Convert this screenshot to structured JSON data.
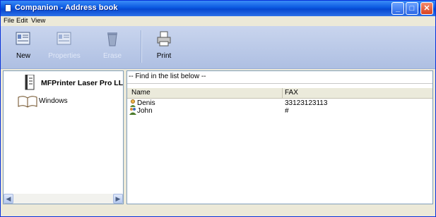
{
  "window": {
    "title": "Companion - Address book"
  },
  "menu": {
    "items": [
      "File",
      "Edit",
      "View"
    ]
  },
  "toolbar": {
    "new_label": "New",
    "properties_label": "Properties",
    "erase_label": "Erase",
    "print_label": "Print"
  },
  "tree": {
    "items": [
      {
        "label": "MFPrinter Laser Pro LL",
        "icon": "printer-book-icon"
      },
      {
        "label": "Windows",
        "icon": "open-book-icon"
      }
    ]
  },
  "find": {
    "placeholder": "-- Find in the list below --"
  },
  "list": {
    "columns": [
      "Name",
      "FAX"
    ],
    "rows": [
      {
        "name": "Denis",
        "fax": "33123123113",
        "icon": "person-icon"
      },
      {
        "name": "John",
        "fax": "#",
        "icon": "group-icon"
      }
    ]
  },
  "colors": {
    "titlebar": "#0a58e0",
    "toolbar": "#aebfe2"
  }
}
